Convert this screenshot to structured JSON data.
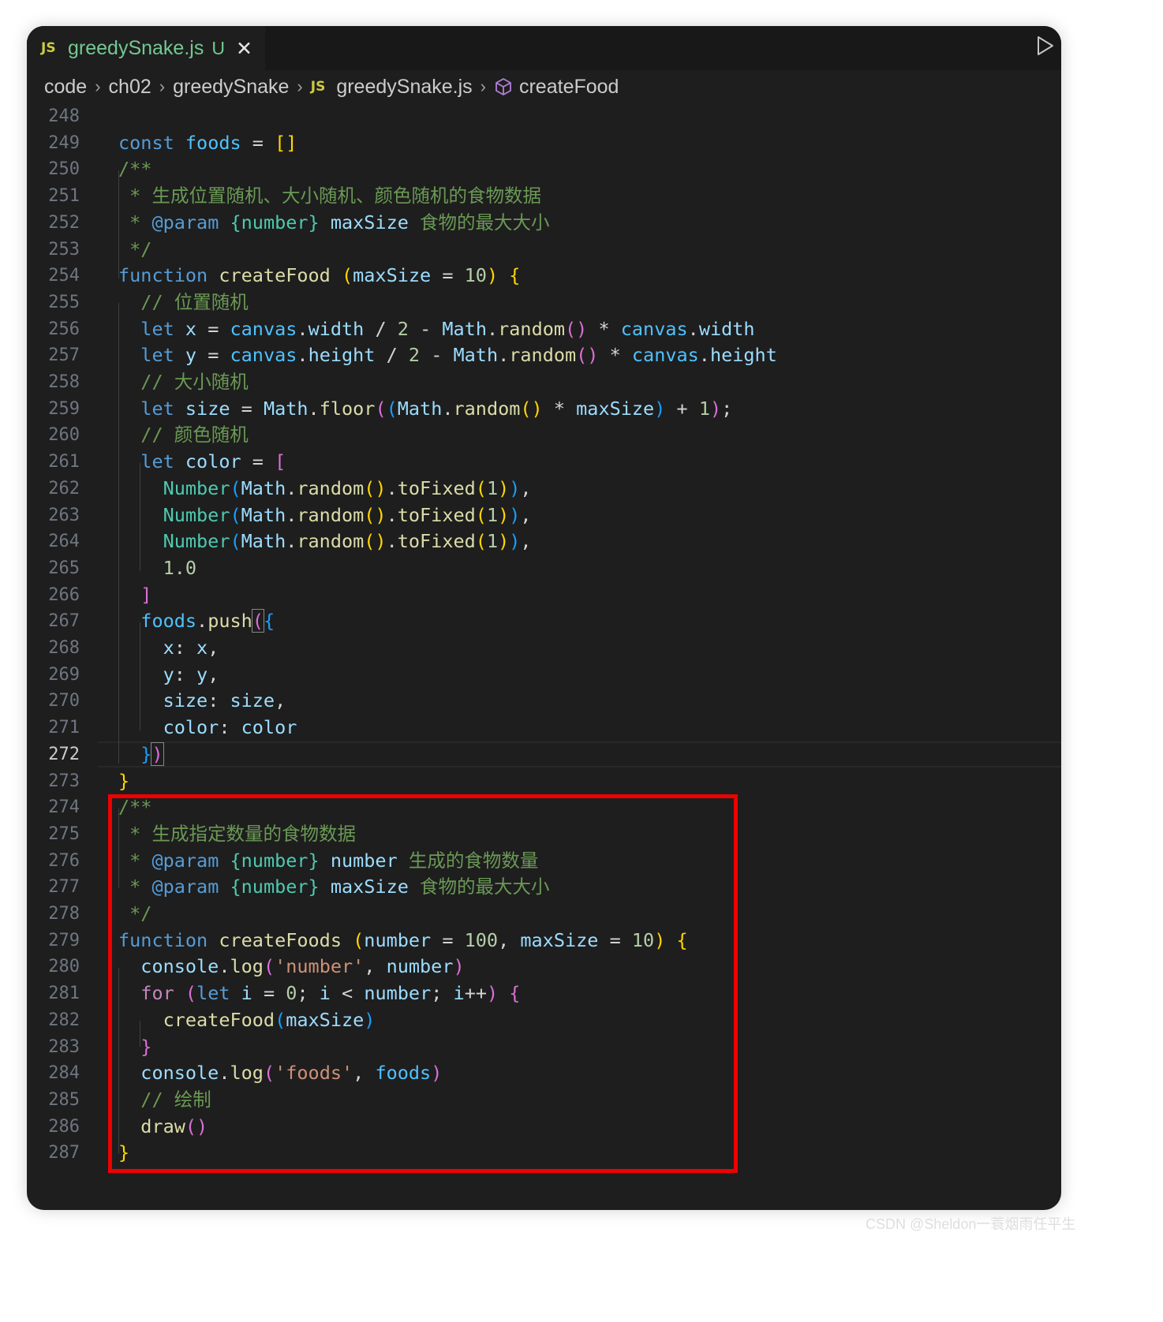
{
  "tab": {
    "lang_badge": "JS",
    "filename": "greedySnake.js",
    "status": "U",
    "close_glyph": "✕"
  },
  "breadcrumb": {
    "items": [
      "code",
      "ch02",
      "greedySnake"
    ],
    "file_badge": "JS",
    "file": "greedySnake.js",
    "symbol": "createFood",
    "symbol_icon": "cube-icon",
    "separator": "›"
  },
  "editor": {
    "active_line": 272,
    "lines": [
      {
        "n": "248",
        "tokens": []
      },
      {
        "n": "249",
        "tokens": [
          [
            "kw",
            "const"
          ],
          [
            "op",
            " "
          ],
          [
            "cn",
            "foods"
          ],
          [
            "op",
            " = "
          ],
          [
            "b1",
            "[]"
          ]
        ]
      },
      {
        "n": "250",
        "tokens": [
          [
            "cm",
            "/**"
          ]
        ]
      },
      {
        "n": "251",
        "tokens": [
          [
            "cm",
            " * 生成位置随机、大小随机、颜色随机的食物数据"
          ]
        ]
      },
      {
        "n": "252",
        "tokens": [
          [
            "cm",
            " * "
          ],
          [
            "jd",
            "@param"
          ],
          [
            "cm",
            " "
          ],
          [
            "jt",
            "{number}"
          ],
          [
            "cm",
            " "
          ],
          [
            "va",
            "maxSize"
          ],
          [
            "cm",
            " 食物的最大大小"
          ]
        ]
      },
      {
        "n": "253",
        "tokens": [
          [
            "cm",
            " */"
          ]
        ]
      },
      {
        "n": "254",
        "tokens": [
          [
            "kw",
            "function"
          ],
          [
            "op",
            " "
          ],
          [
            "fn",
            "createFood"
          ],
          [
            "op",
            " "
          ],
          [
            "b1",
            "("
          ],
          [
            "va",
            "maxSize"
          ],
          [
            "op",
            " = "
          ],
          [
            "nu",
            "10"
          ],
          [
            "b1",
            ")"
          ],
          [
            "op",
            " "
          ],
          [
            "b1",
            "{"
          ]
        ]
      },
      {
        "n": "255",
        "tokens": [
          [
            "op",
            "  "
          ],
          [
            "cm",
            "// 位置随机"
          ]
        ]
      },
      {
        "n": "256",
        "tokens": [
          [
            "op",
            "  "
          ],
          [
            "kw",
            "let"
          ],
          [
            "op",
            " "
          ],
          [
            "va",
            "x"
          ],
          [
            "op",
            " = "
          ],
          [
            "cn",
            "canvas"
          ],
          [
            "op",
            "."
          ],
          [
            "va",
            "width"
          ],
          [
            "op",
            " / "
          ],
          [
            "nu",
            "2"
          ],
          [
            "op",
            " - "
          ],
          [
            "va",
            "Math"
          ],
          [
            "op",
            "."
          ],
          [
            "fn",
            "random"
          ],
          [
            "b2",
            "()"
          ],
          [
            "op",
            " * "
          ],
          [
            "cn",
            "canvas"
          ],
          [
            "op",
            "."
          ],
          [
            "va",
            "width"
          ]
        ]
      },
      {
        "n": "257",
        "tokens": [
          [
            "op",
            "  "
          ],
          [
            "kw",
            "let"
          ],
          [
            "op",
            " "
          ],
          [
            "va",
            "y"
          ],
          [
            "op",
            " = "
          ],
          [
            "cn",
            "canvas"
          ],
          [
            "op",
            "."
          ],
          [
            "va",
            "height"
          ],
          [
            "op",
            " / "
          ],
          [
            "nu",
            "2"
          ],
          [
            "op",
            " - "
          ],
          [
            "va",
            "Math"
          ],
          [
            "op",
            "."
          ],
          [
            "fn",
            "random"
          ],
          [
            "b2",
            "()"
          ],
          [
            "op",
            " * "
          ],
          [
            "cn",
            "canvas"
          ],
          [
            "op",
            "."
          ],
          [
            "va",
            "height"
          ]
        ]
      },
      {
        "n": "258",
        "tokens": [
          [
            "op",
            "  "
          ],
          [
            "cm",
            "// 大小随机"
          ]
        ]
      },
      {
        "n": "259",
        "tokens": [
          [
            "op",
            "  "
          ],
          [
            "kw",
            "let"
          ],
          [
            "op",
            " "
          ],
          [
            "va",
            "size"
          ],
          [
            "op",
            " = "
          ],
          [
            "va",
            "Math"
          ],
          [
            "op",
            "."
          ],
          [
            "fn",
            "floor"
          ],
          [
            "b2",
            "("
          ],
          [
            "b3",
            "("
          ],
          [
            "va",
            "Math"
          ],
          [
            "op",
            "."
          ],
          [
            "fn",
            "random"
          ],
          [
            "b1",
            "()"
          ],
          [
            "op",
            " * "
          ],
          [
            "va",
            "maxSize"
          ],
          [
            "b3",
            ")"
          ],
          [
            "op",
            " + "
          ],
          [
            "nu",
            "1"
          ],
          [
            "b2",
            ")"
          ],
          [
            "op",
            ";"
          ]
        ]
      },
      {
        "n": "260",
        "tokens": [
          [
            "op",
            "  "
          ],
          [
            "cm",
            "// 颜色随机"
          ]
        ]
      },
      {
        "n": "261",
        "tokens": [
          [
            "op",
            "  "
          ],
          [
            "kw",
            "let"
          ],
          [
            "op",
            " "
          ],
          [
            "va",
            "color"
          ],
          [
            "op",
            " = "
          ],
          [
            "b2",
            "["
          ]
        ]
      },
      {
        "n": "262",
        "tokens": [
          [
            "op",
            "    "
          ],
          [
            "cl",
            "Number"
          ],
          [
            "b3",
            "("
          ],
          [
            "va",
            "Math"
          ],
          [
            "op",
            "."
          ],
          [
            "fn",
            "random"
          ],
          [
            "b1",
            "()"
          ],
          [
            "op",
            "."
          ],
          [
            "fn",
            "toFixed"
          ],
          [
            "b1",
            "("
          ],
          [
            "nu",
            "1"
          ],
          [
            "b1",
            ")"
          ],
          [
            "b3",
            ")"
          ],
          [
            "op",
            ","
          ]
        ]
      },
      {
        "n": "263",
        "tokens": [
          [
            "op",
            "    "
          ],
          [
            "cl",
            "Number"
          ],
          [
            "b3",
            "("
          ],
          [
            "va",
            "Math"
          ],
          [
            "op",
            "."
          ],
          [
            "fn",
            "random"
          ],
          [
            "b1",
            "()"
          ],
          [
            "op",
            "."
          ],
          [
            "fn",
            "toFixed"
          ],
          [
            "b1",
            "("
          ],
          [
            "nu",
            "1"
          ],
          [
            "b1",
            ")"
          ],
          [
            "b3",
            ")"
          ],
          [
            "op",
            ","
          ]
        ]
      },
      {
        "n": "264",
        "tokens": [
          [
            "op",
            "    "
          ],
          [
            "cl",
            "Number"
          ],
          [
            "b3",
            "("
          ],
          [
            "va",
            "Math"
          ],
          [
            "op",
            "."
          ],
          [
            "fn",
            "random"
          ],
          [
            "b1",
            "()"
          ],
          [
            "op",
            "."
          ],
          [
            "fn",
            "toFixed"
          ],
          [
            "b1",
            "("
          ],
          [
            "nu",
            "1"
          ],
          [
            "b1",
            ")"
          ],
          [
            "b3",
            ")"
          ],
          [
            "op",
            ","
          ]
        ]
      },
      {
        "n": "265",
        "tokens": [
          [
            "op",
            "    "
          ],
          [
            "nu",
            "1.0"
          ]
        ]
      },
      {
        "n": "266",
        "tokens": [
          [
            "op",
            "  "
          ],
          [
            "b2",
            "]"
          ]
        ]
      },
      {
        "n": "267",
        "tokens": [
          [
            "op",
            "  "
          ],
          [
            "cn",
            "foods"
          ],
          [
            "op",
            "."
          ],
          [
            "fn",
            "push"
          ],
          [
            "b2bm",
            "("
          ],
          [
            "b3",
            "{"
          ]
        ]
      },
      {
        "n": "268",
        "tokens": [
          [
            "op",
            "    "
          ],
          [
            "va",
            "x"
          ],
          [
            "op",
            ": "
          ],
          [
            "va",
            "x"
          ],
          [
            "op",
            ","
          ]
        ]
      },
      {
        "n": "269",
        "tokens": [
          [
            "op",
            "    "
          ],
          [
            "va",
            "y"
          ],
          [
            "op",
            ": "
          ],
          [
            "va",
            "y"
          ],
          [
            "op",
            ","
          ]
        ]
      },
      {
        "n": "270",
        "tokens": [
          [
            "op",
            "    "
          ],
          [
            "va",
            "size"
          ],
          [
            "op",
            ": "
          ],
          [
            "va",
            "size"
          ],
          [
            "op",
            ","
          ]
        ]
      },
      {
        "n": "271",
        "tokens": [
          [
            "op",
            "    "
          ],
          [
            "va",
            "color"
          ],
          [
            "op",
            ": "
          ],
          [
            "va",
            "color"
          ]
        ]
      },
      {
        "n": "272",
        "tokens": [
          [
            "op",
            "  "
          ],
          [
            "b3",
            "}"
          ],
          [
            "b2bm",
            ")"
          ]
        ]
      },
      {
        "n": "273",
        "tokens": [
          [
            "b1",
            "}"
          ]
        ]
      },
      {
        "n": "274",
        "tokens": [
          [
            "cm",
            "/**"
          ]
        ]
      },
      {
        "n": "275",
        "tokens": [
          [
            "cm",
            " * 生成指定数量的食物数据"
          ]
        ]
      },
      {
        "n": "276",
        "tokens": [
          [
            "cm",
            " * "
          ],
          [
            "jd",
            "@param"
          ],
          [
            "cm",
            " "
          ],
          [
            "jt",
            "{number}"
          ],
          [
            "cm",
            " "
          ],
          [
            "va",
            "number"
          ],
          [
            "cm",
            " 生成的食物数量"
          ]
        ]
      },
      {
        "n": "277",
        "tokens": [
          [
            "cm",
            " * "
          ],
          [
            "jd",
            "@param"
          ],
          [
            "cm",
            " "
          ],
          [
            "jt",
            "{number}"
          ],
          [
            "cm",
            " "
          ],
          [
            "va",
            "maxSize"
          ],
          [
            "cm",
            " 食物的最大大小"
          ]
        ]
      },
      {
        "n": "278",
        "tokens": [
          [
            "cm",
            " */"
          ]
        ]
      },
      {
        "n": "279",
        "tokens": [
          [
            "kw",
            "function"
          ],
          [
            "op",
            " "
          ],
          [
            "fn",
            "createFoods"
          ],
          [
            "op",
            " "
          ],
          [
            "b1",
            "("
          ],
          [
            "va",
            "number"
          ],
          [
            "op",
            " = "
          ],
          [
            "nu",
            "100"
          ],
          [
            "op",
            ", "
          ],
          [
            "va",
            "maxSize"
          ],
          [
            "op",
            " = "
          ],
          [
            "nu",
            "10"
          ],
          [
            "b1",
            ")"
          ],
          [
            "op",
            " "
          ],
          [
            "b1",
            "{"
          ]
        ]
      },
      {
        "n": "280",
        "tokens": [
          [
            "op",
            "  "
          ],
          [
            "va",
            "console"
          ],
          [
            "op",
            "."
          ],
          [
            "fn",
            "log"
          ],
          [
            "b2",
            "("
          ],
          [
            "st",
            "'number'"
          ],
          [
            "op",
            ", "
          ],
          [
            "va",
            "number"
          ],
          [
            "b2",
            ")"
          ]
        ]
      },
      {
        "n": "281",
        "tokens": [
          [
            "op",
            "  "
          ],
          [
            "kw2",
            "for"
          ],
          [
            "op",
            " "
          ],
          [
            "b2",
            "("
          ],
          [
            "kw",
            "let"
          ],
          [
            "op",
            " "
          ],
          [
            "va",
            "i"
          ],
          [
            "op",
            " = "
          ],
          [
            "nu",
            "0"
          ],
          [
            "op",
            "; "
          ],
          [
            "va",
            "i"
          ],
          [
            "op",
            " < "
          ],
          [
            "va",
            "number"
          ],
          [
            "op",
            "; "
          ],
          [
            "va",
            "i"
          ],
          [
            "op",
            "++"
          ],
          [
            "b2",
            ")"
          ],
          [
            "op",
            " "
          ],
          [
            "b2",
            "{"
          ]
        ]
      },
      {
        "n": "282",
        "tokens": [
          [
            "op",
            "    "
          ],
          [
            "fn",
            "createFood"
          ],
          [
            "b3",
            "("
          ],
          [
            "va",
            "maxSize"
          ],
          [
            "b3",
            ")"
          ]
        ]
      },
      {
        "n": "283",
        "tokens": [
          [
            "op",
            "  "
          ],
          [
            "b2",
            "}"
          ]
        ]
      },
      {
        "n": "284",
        "tokens": [
          [
            "op",
            "  "
          ],
          [
            "va",
            "console"
          ],
          [
            "op",
            "."
          ],
          [
            "fn",
            "log"
          ],
          [
            "b2",
            "("
          ],
          [
            "st",
            "'foods'"
          ],
          [
            "op",
            ", "
          ],
          [
            "cn",
            "foods"
          ],
          [
            "b2",
            ")"
          ]
        ]
      },
      {
        "n": "285",
        "tokens": [
          [
            "op",
            "  "
          ],
          [
            "cm",
            "// 绘制"
          ]
        ]
      },
      {
        "n": "286",
        "tokens": [
          [
            "op",
            "  "
          ],
          [
            "fn",
            "draw"
          ],
          [
            "b2",
            "()"
          ]
        ]
      },
      {
        "n": "287",
        "tokens": [
          [
            "b1",
            "}"
          ]
        ]
      }
    ]
  },
  "watermark": "CSDN @Sheldon一蓑烟雨任平生"
}
